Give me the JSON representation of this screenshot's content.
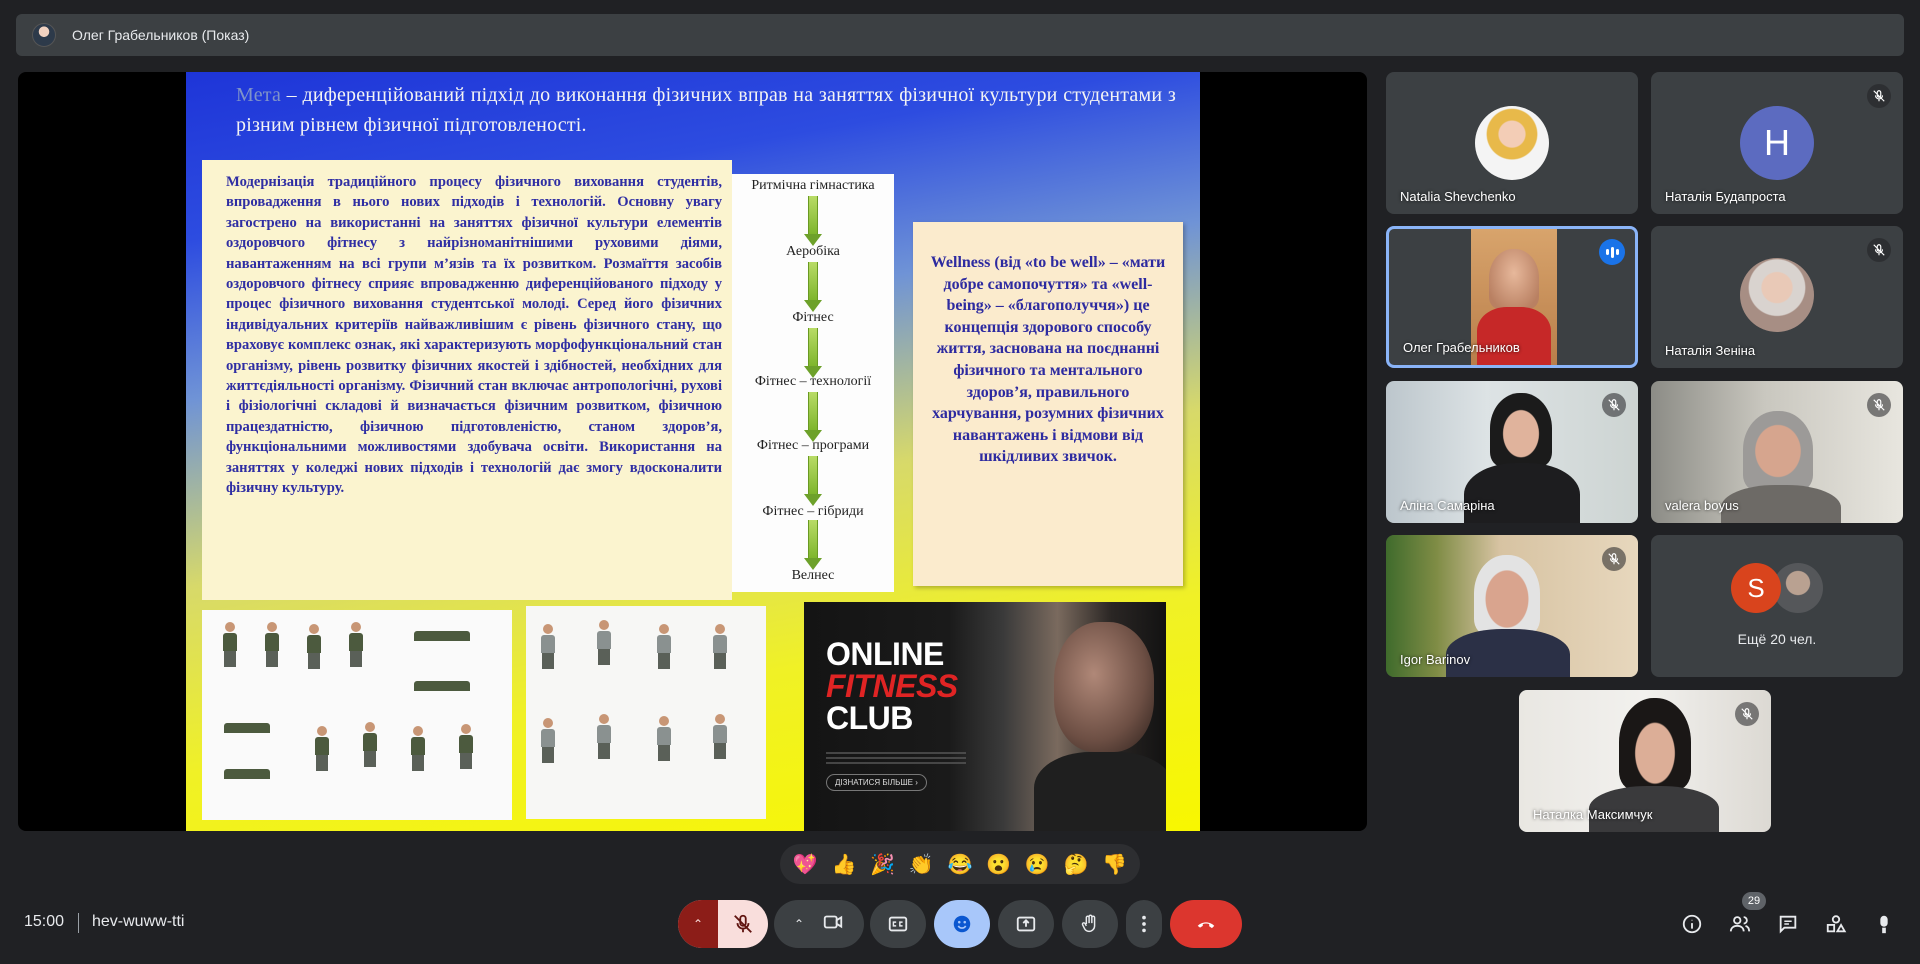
{
  "header": {
    "presenter_title": "Олег Грабельников (Показ)"
  },
  "slide": {
    "heading_lead": "Мета",
    "heading_rest": " – диференційований підхід до виконання фізичних вправ на заняттях фізичної культури студентами з різним рівнем фізичної підготовленості.",
    "body_text": "Модернізація традиційного процесу фізичного виховання студентів, впровадження в нього нових підходів і технологій. Основну увагу загострено на використанні на заняттях фізичної культури елементів оздоровчого фітнесу з найрізноманітнішими руховими діями, навантаженням на всі групи м’язів та їх розвитком. Розмаїття засобів оздоровчого фітнесу сприяє впровадженню диференційованого підходу у процес фізичного виховання студентської молоді. Серед його фізичних індивідуальних критеріїв найважливішим є рівень фізичного стану, що враховує комплекс ознак, які характеризують морфофункціональний стан організму, рівень розвитку фізичних якостей і здібностей, необхідних для життєдіяльності організму. Фізичний стан включає антропологічні, рухові і фізіологічні складові й визначається фізичним розвитком, фізичною працездатністю, фізичною підготовленістю, станом здоров’я, функціональними можливостями здобувача освіти. Використання на заняттях у коледжі нових підходів і технологій дає змогу вдосконалити фізичну культуру.",
    "flow_steps": [
      "Ритмічна гімнастика",
      "Аеробіка",
      "Фітнес",
      "Фітнес – технології",
      "Фітнес – програми",
      "Фітнес – гібриди",
      "Велнес"
    ],
    "wellness_text": "Wellness (від «to be well» – «мати добре самопочуття» та «well-being» – «благополуччя») це концепція здорового способу життя, заснована на поєднанні фізичного та ментального здоров’я, правильного харчування, розумних фізичних навантажень і відмови від шкідливих звичок.",
    "poster": {
      "line1": "ONLINE",
      "line2": "FITNESS",
      "line3": "CLUB",
      "pill": "ДІЗНАТИСЯ БІЛЬШЕ ›"
    }
  },
  "participants": [
    {
      "name": "Natalia Shevchenko",
      "muted": false
    },
    {
      "name": "Наталія Будапроста",
      "muted": true,
      "initial": "H"
    },
    {
      "name": "Олег Грабельников",
      "muted": false,
      "speaking": true
    },
    {
      "name": "Наталія Зеніна",
      "muted": true
    },
    {
      "name": "Аліна Самаріна",
      "muted": true
    },
    {
      "name": "valera boyus",
      "muted": true
    },
    {
      "name": "Igor Barinov",
      "muted": true
    },
    {
      "more_label": "Ещё 20 чел.",
      "initial": "S"
    },
    {
      "name": "Наталка Максимчук",
      "muted": true
    }
  ],
  "reactions": [
    "💖",
    "👍",
    "🎉",
    "👏",
    "😂",
    "😮",
    "😢",
    "🤔",
    "👎"
  ],
  "footer": {
    "time": "15:00",
    "meeting_code": "hev-wuww-tti",
    "participant_count": "29"
  },
  "colors": {
    "accent": "#8ab4f8",
    "end_call": "#ea4335",
    "mic_muted_bg": "#f9dedc",
    "emoji_active": "#a8c7fa"
  },
  "icons": [
    "mic-off-icon",
    "camera-icon",
    "captions-icon",
    "emoji-icon",
    "present-icon",
    "raise-hand-icon",
    "more-vert-icon",
    "end-call-icon",
    "info-icon",
    "people-icon",
    "chat-icon",
    "activities-icon",
    "host-controls-icon"
  ]
}
